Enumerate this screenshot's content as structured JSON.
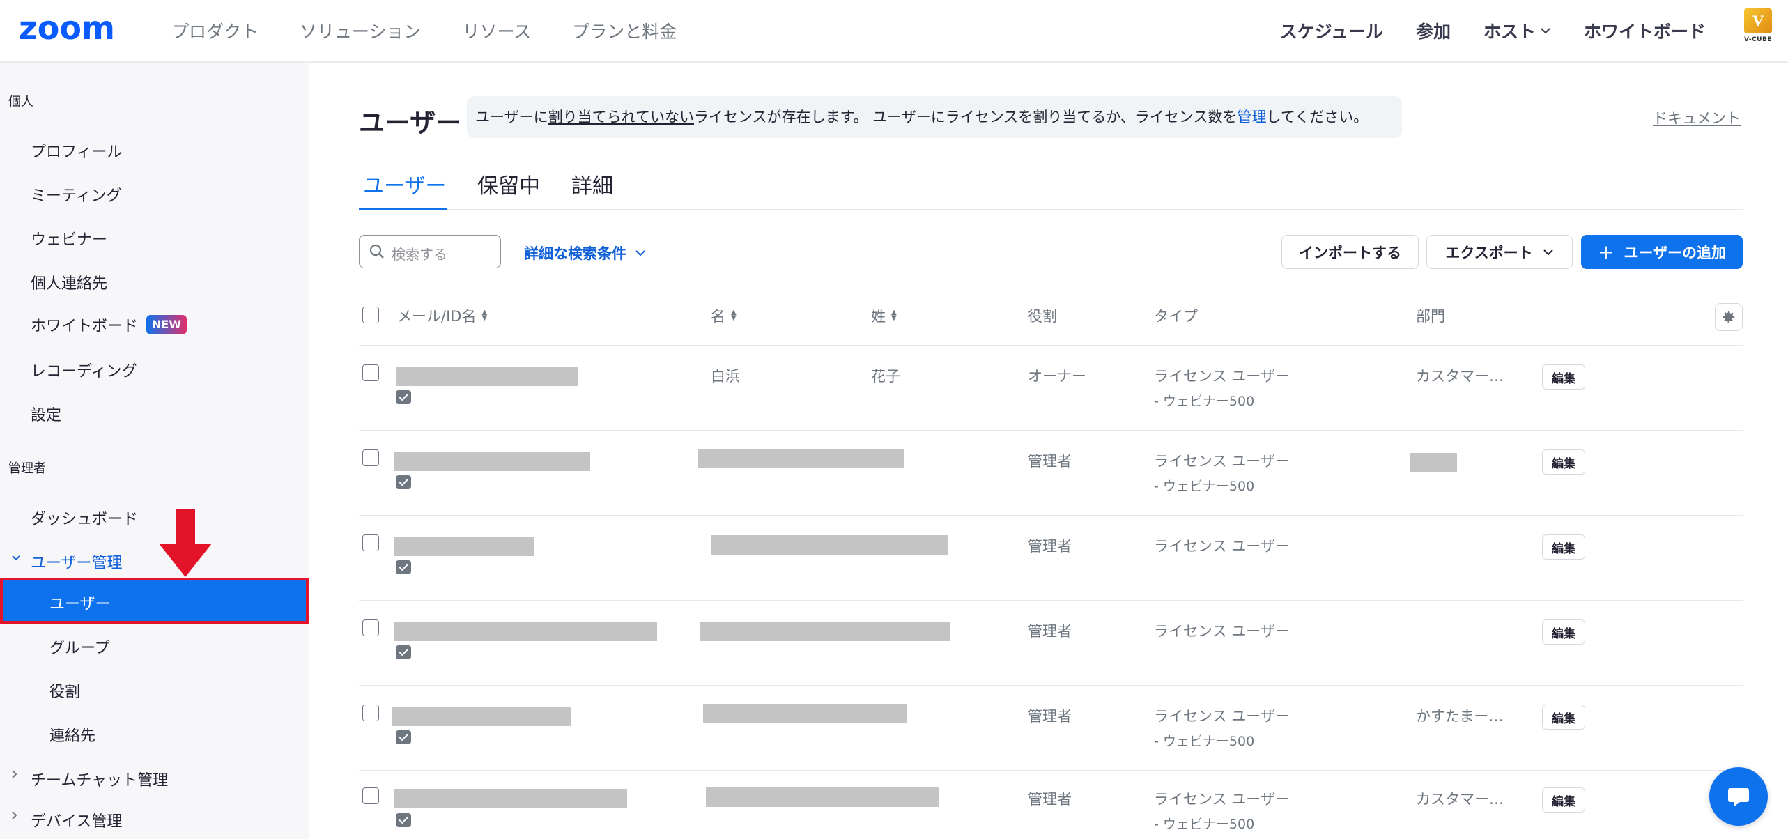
{
  "brand": {
    "logo_text": "zoom",
    "accent": "#0e72ed",
    "partner_logo_text": "V-CUBE"
  },
  "nav": {
    "left": [
      "プロダクト",
      "ソリューション",
      "リソース",
      "プランと料金"
    ],
    "right": [
      "スケジュール",
      "参加",
      "ホスト",
      "ホワイトボード"
    ]
  },
  "sidebar": {
    "personal_heading": "個人",
    "personal_items": [
      "プロフィール",
      "ミーティング",
      "ウェビナー",
      "個人連絡先",
      "ホワイトボード",
      "レコーディング",
      "設定"
    ],
    "new_badge": "NEW",
    "admin_heading": "管理者",
    "dashboard": "ダッシュボード",
    "user_mgmt": "ユーザー管理",
    "user_mgmt_items": [
      "ユーザー",
      "グループ",
      "役割",
      "連絡先"
    ],
    "team_chat": "チームチャット管理",
    "device_mgmt": "デバイス管理"
  },
  "page": {
    "title": "ユーザー",
    "notice_pre": "ユーザーに",
    "notice_underline": "割り当てられていない",
    "notice_mid": "ライセンスが存在します。 ユーザーにライセンスを割り当てるか、ライセンス数を",
    "notice_link": "管理",
    "notice_post": "してください。",
    "doc_link": "ドキュメント"
  },
  "tabs": [
    "ユーザー",
    "保留中",
    "詳細"
  ],
  "toolbar": {
    "search_placeholder": "検索する",
    "advanced_search": "詳細な検索条件",
    "import": "インポートする",
    "export": "エクスポート",
    "add_user": "ユーザーの追加"
  },
  "table": {
    "headers": {
      "email": "メール/ID名",
      "first": "名",
      "last": "姓",
      "role": "役割",
      "type": "タイプ",
      "dept": "部門"
    },
    "edit_label": "編集",
    "rows": [
      {
        "first": "白浜",
        "last": "花子",
        "role": "オーナー",
        "type": "ライセンス ユーザー",
        "type_sub": "- ウェビナー500",
        "dept": "カスタマー…"
      },
      {
        "first": "",
        "last": "",
        "role": "管理者",
        "type": "ライセンス ユーザー",
        "type_sub": "- ウェビナー500",
        "dept": ""
      },
      {
        "first": "",
        "last": "",
        "role": "管理者",
        "type": "ライセンス ユーザー",
        "type_sub": "",
        "dept": ""
      },
      {
        "first": "",
        "last": "",
        "role": "管理者",
        "type": "ライセンス ユーザー",
        "type_sub": "",
        "dept": ""
      },
      {
        "first": "",
        "last": "",
        "role": "管理者",
        "type": "ライセンス ユーザー",
        "type_sub": "- ウェビナー500",
        "dept": "かすたまー…"
      },
      {
        "first": "",
        "last": "",
        "role": "管理者",
        "type": "ライセンス ユーザー",
        "type_sub": "- ウェビナー500",
        "dept": "カスタマー…"
      }
    ]
  }
}
